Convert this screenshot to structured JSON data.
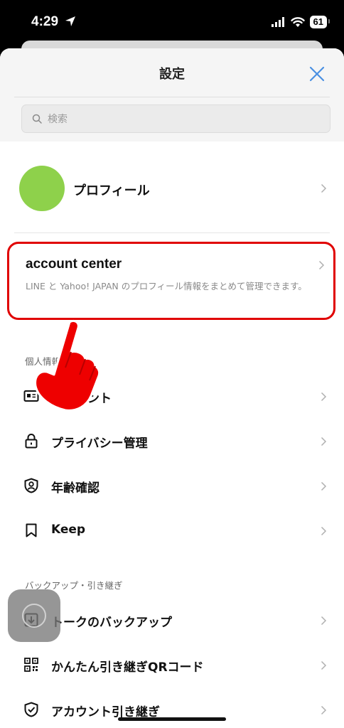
{
  "status_bar": {
    "time": "4:29",
    "battery": "61"
  },
  "header": {
    "title": "設定"
  },
  "search": {
    "placeholder": "検索"
  },
  "profile": {
    "label": "プロフィール"
  },
  "account_center": {
    "title": "account center",
    "description": "LINE と Yahoo! JAPAN のプロフィール情報をまとめて管理できます。"
  },
  "sections": {
    "personal": "個人情報",
    "backup": "バックアップ・引き継ぎ"
  },
  "items": [
    {
      "label": "アカウント"
    },
    {
      "label": "プライバシー管理"
    },
    {
      "label": "年齢確認"
    },
    {
      "label": "Keep"
    },
    {
      "label": "トークのバックアップ"
    },
    {
      "label": "かんたん引き継ぎQRコード"
    },
    {
      "label": "アカウント引き継ぎ"
    }
  ],
  "colors": {
    "accent_blue": "#4a90e2",
    "highlight_red": "#e00000",
    "avatar_green": "#8ed14b"
  }
}
